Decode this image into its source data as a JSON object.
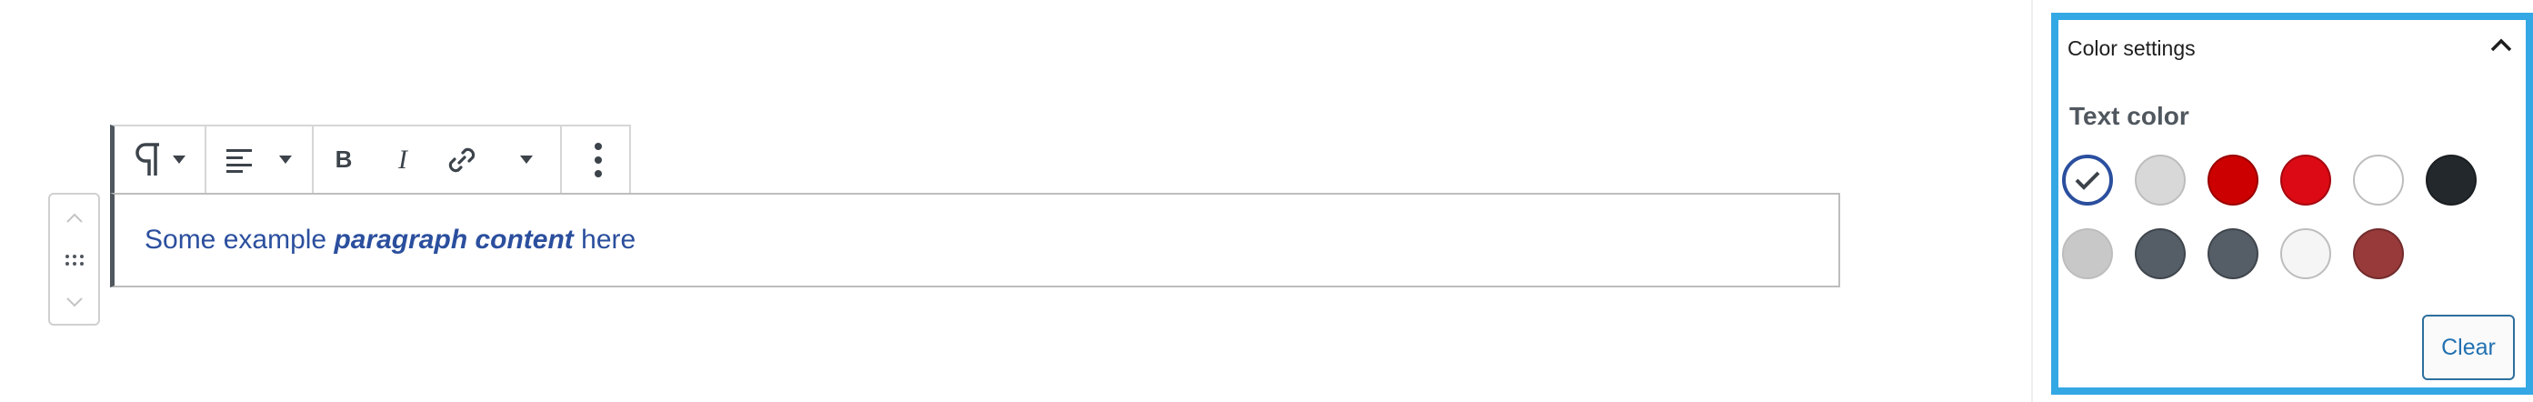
{
  "block": {
    "text_before": "Some example ",
    "text_emphasis": "paragraph content",
    "text_after": " here"
  },
  "toolbar": {
    "icons": [
      "paragraph-icon",
      "align-left-icon",
      "bold-icon",
      "italic-icon",
      "link-icon",
      "more-options-icon"
    ],
    "bold_glyph": "B",
    "italic_glyph": "I"
  },
  "sidebar": {
    "panel_title": "Color settings",
    "section_title": "Text color",
    "clear_label": "Clear",
    "swatches": [
      {
        "color": "#ffffff",
        "selected": true
      },
      {
        "color": "#d8d8d8",
        "selected": false
      },
      {
        "color": "#cc0000",
        "selected": false
      },
      {
        "color": "#dc0a14",
        "selected": false
      },
      {
        "color": "#ffffff",
        "selected": false
      },
      {
        "color": "#23282d",
        "selected": false
      },
      {
        "color": "#c8c8c8",
        "selected": false
      },
      {
        "color": "#555d66",
        "selected": false
      },
      {
        "color": "#555d66",
        "selected": false
      },
      {
        "color": "#f5f5f5",
        "selected": false
      },
      {
        "color": "#983a3a",
        "selected": false
      }
    ]
  },
  "colors": {
    "accent": "#34a8e4",
    "text_link": "#2271b1",
    "paragraph_text": "#2b4f9e",
    "check_ring": "#2b4f9e"
  }
}
